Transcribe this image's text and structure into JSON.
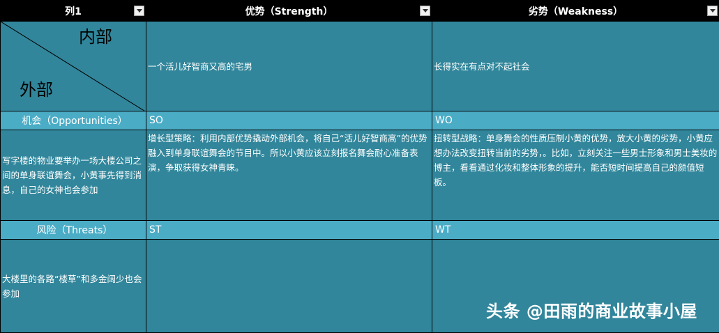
{
  "header": {
    "col1": "列1",
    "col2": "优势（Strength）",
    "col3": "劣势（Weakness）"
  },
  "matrix": {
    "inner_label": "内部",
    "outer_label": "外部",
    "strength_desc": "一个活儿好智商又高的宅男",
    "weakness_desc": "长得实在有点对不起社会"
  },
  "opportunities": {
    "label": "机会（Opportunities）",
    "so_label": "SO",
    "wo_label": "WO",
    "desc": "写字楼的物业要举办一场大楼公司之间的单身联谊舞会，小黄事先得到消息，自己的女神也会参加",
    "so_text": "增长型策略：利用内部优势撬动外部机会，将自己“活儿好智商高”的优势融入到单身联谊舞会的节目中。所以小黄应该立刻报名舞会耐心准备表演，争取获得女神青睐。",
    "wo_text": "扭转型战略：单身舞会的性质压制小黄的优势，放大小黄的劣势，小黄应想办法改变扭转当前的劣势，。比如，立刻关注一些男士形象和男士美妆的博主，看看通过化妆和整体形象的提升，能否短时间提高自己的颜值短板。"
  },
  "threats": {
    "label": "风险（Threats）",
    "st_label": "ST",
    "wt_label": "WT",
    "desc": "大楼里的各路“楼草”和多金阔少也会参加",
    "st_text": "",
    "wt_text": ""
  },
  "watermark": "头条 @田雨的商业故事小屋",
  "colors": {
    "dark_teal": "#31869B",
    "light_teal": "#4BACC6",
    "header_bg": "#000000"
  }
}
